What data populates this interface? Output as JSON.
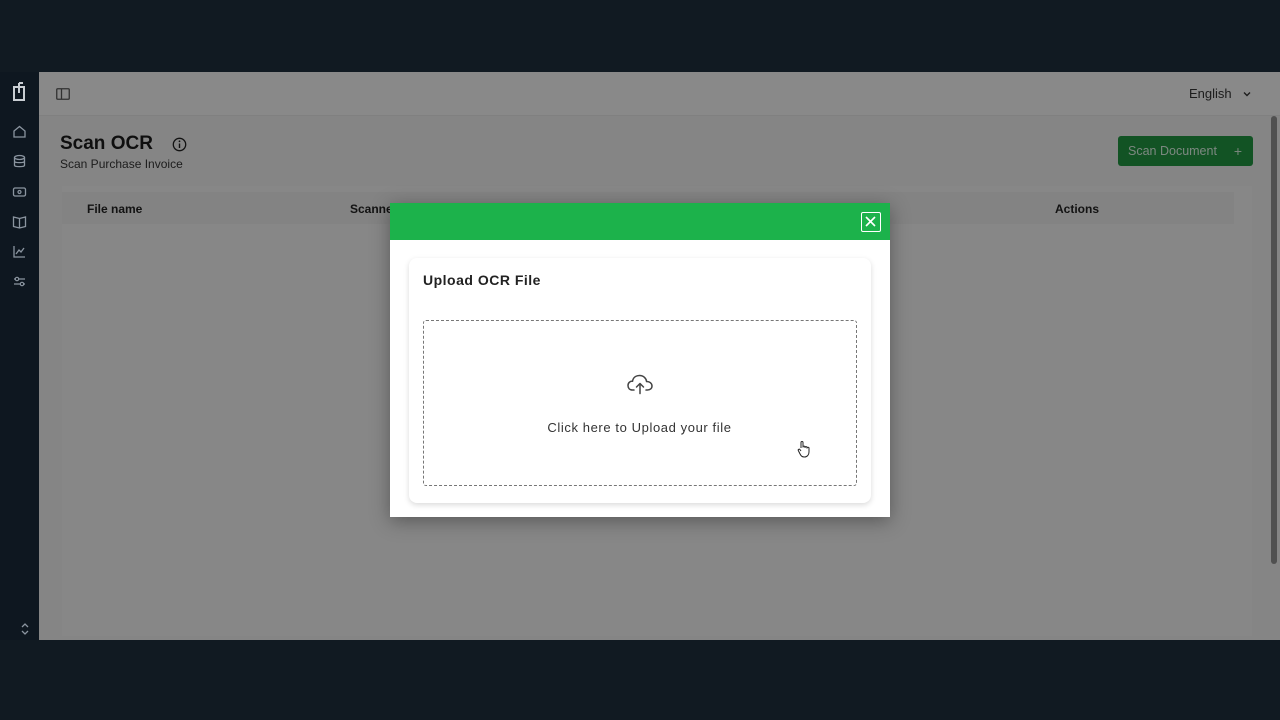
{
  "header": {
    "language": "English"
  },
  "page": {
    "title": "Scan OCR",
    "subtitle": "Scan Purchase Invoice",
    "scan_button_label": "Scan Document",
    "scan_button_icon": "+"
  },
  "table": {
    "columns": [
      "File name",
      "Scanne",
      "Actions"
    ]
  },
  "modal": {
    "title": "Upload OCR File",
    "dropzone_text": "Click here to Upload your file",
    "header_color": "#1cb24b"
  },
  "sidebar": {
    "icons": [
      "home-icon",
      "database-icon",
      "card-icon",
      "book-icon",
      "chart-icon",
      "settings-sliders-icon"
    ]
  },
  "colors": {
    "accent": "#1cb24b",
    "button": "#1f8f3f"
  }
}
